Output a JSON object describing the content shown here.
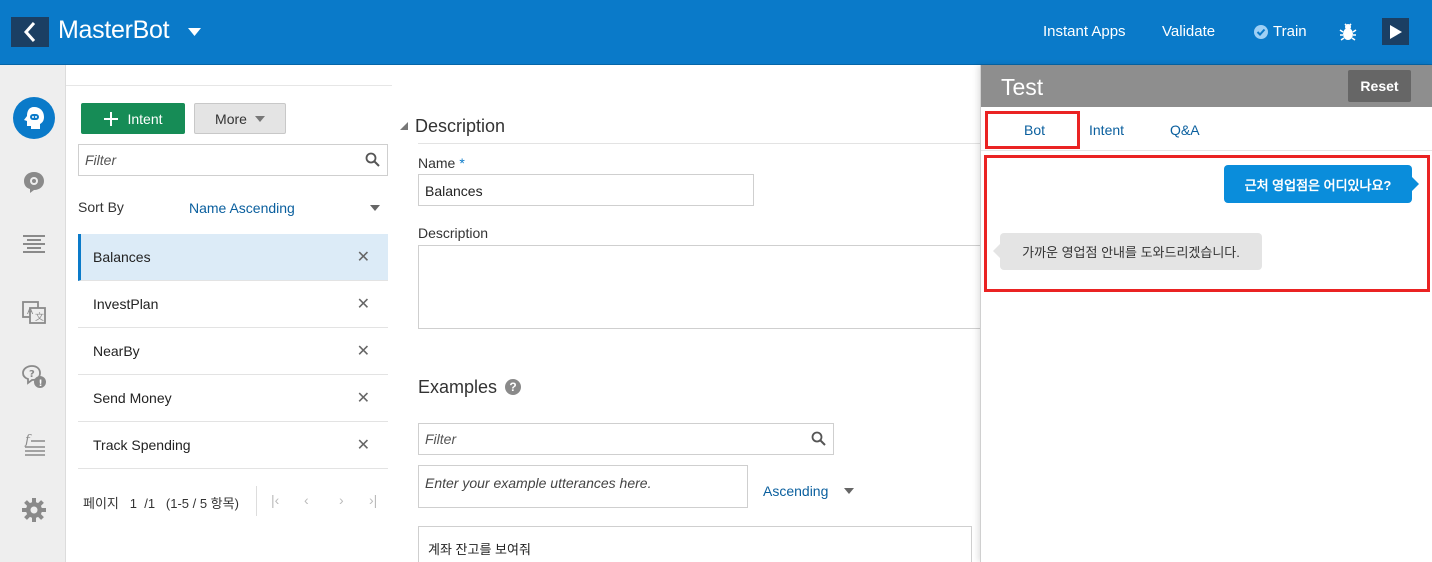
{
  "header": {
    "app_title": "MasterBot",
    "links": {
      "instant_apps": "Instant Apps",
      "validate": "Validate",
      "train": "Train"
    }
  },
  "rail": {
    "items": [
      "intents-icon",
      "entities-icon",
      "flows-icon",
      "resource-bundles-icon",
      "qna-icon",
      "components-icon",
      "settings-icon"
    ]
  },
  "intents_panel": {
    "add_intent_label": "Intent",
    "more_label": "More",
    "filter_placeholder": "Filter",
    "sort_by_label": "Sort By",
    "sort_by_value": "Name Ascending",
    "intents": [
      {
        "label": "Balances",
        "selected": true
      },
      {
        "label": "InvestPlan"
      },
      {
        "label": "NearBy"
      },
      {
        "label": "Send Money"
      },
      {
        "label": "Track Spending"
      }
    ],
    "pager": {
      "page_label": "페이지",
      "current_page": "1",
      "total": "/1",
      "range": "(1-5 / 5 항목)"
    }
  },
  "editor": {
    "section_title": "Description",
    "name_label": "Name",
    "name_required": "*",
    "name_value": "Balances",
    "description_label": "Description",
    "description_value": "",
    "examples_title": "Examples",
    "help_glyph": "?",
    "examples_filter_placeholder": "Filter",
    "utterance_placeholder": "Enter your example utterances here.",
    "sort_order": "Ascending",
    "examples": [
      "계좌 잔고를 보여줘"
    ]
  },
  "test_panel": {
    "title": "Test",
    "reset_label": "Reset",
    "tabs": [
      {
        "label": "Bot",
        "active": true
      },
      {
        "label": "Intent"
      },
      {
        "label": "Q&A"
      }
    ],
    "messages": {
      "user": "근처 영업점은 어디있나요?",
      "bot": "가까운 영업점 안내를 도와드리겠습니다."
    }
  },
  "colors": {
    "header_blue": "#0a7ac9",
    "primary_green": "#168c56",
    "highlight_red": "#ea2323"
  }
}
